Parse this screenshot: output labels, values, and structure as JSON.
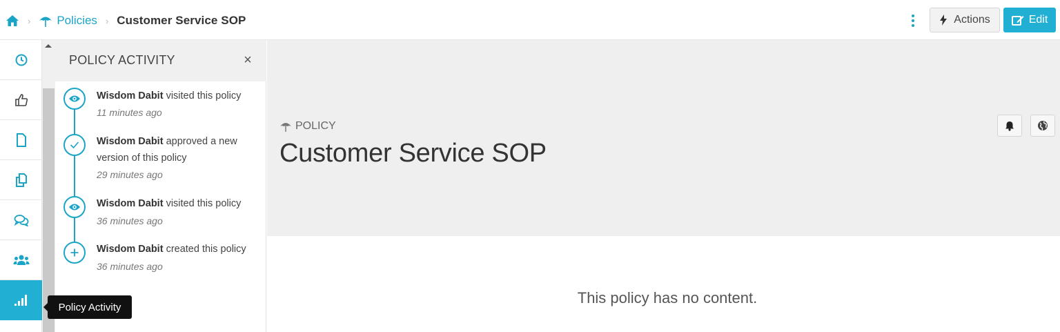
{
  "breadcrumb": {
    "home_icon": "home-icon",
    "separator": "›",
    "policies_label": "Policies",
    "current": "Customer Service SOP"
  },
  "header": {
    "actions_label": "Actions",
    "edit_label": "Edit",
    "accent_color": "#21b0d3"
  },
  "rail": {
    "items": [
      {
        "icon": "clock-icon"
      },
      {
        "icon": "thumbs-up-icon"
      },
      {
        "icon": "file-icon"
      },
      {
        "icon": "copy-icon"
      },
      {
        "icon": "comments-icon"
      },
      {
        "icon": "users-icon"
      },
      {
        "icon": "signal-icon",
        "active": true
      }
    ]
  },
  "activity_panel": {
    "title": "POLICY ACTIVITY",
    "close_glyph": "×",
    "entries": [
      {
        "icon": "eye-icon",
        "user": "Wisdom Dabit",
        "action_line1": " visited this policy",
        "action_line2": "",
        "time": "11 minutes ago"
      },
      {
        "icon": "check-icon",
        "user": "Wisdom Dabit",
        "action_line1": " approved a new",
        "action_line2": "version of this policy",
        "time": "29 minutes ago"
      },
      {
        "icon": "eye-icon",
        "user": "Wisdom Dabit",
        "action_line1": " visited this policy",
        "action_line2": "",
        "time": "36 minutes ago"
      },
      {
        "icon": "plus-icon",
        "user": "Wisdom Dabit",
        "action_line1": " created this policy",
        "action_line2": "",
        "time": "36 minutes ago"
      }
    ]
  },
  "tooltip": {
    "text": "Policy Activity"
  },
  "main": {
    "label": "POLICY",
    "title": "Customer Service SOP",
    "empty_message": "This policy has no content."
  }
}
